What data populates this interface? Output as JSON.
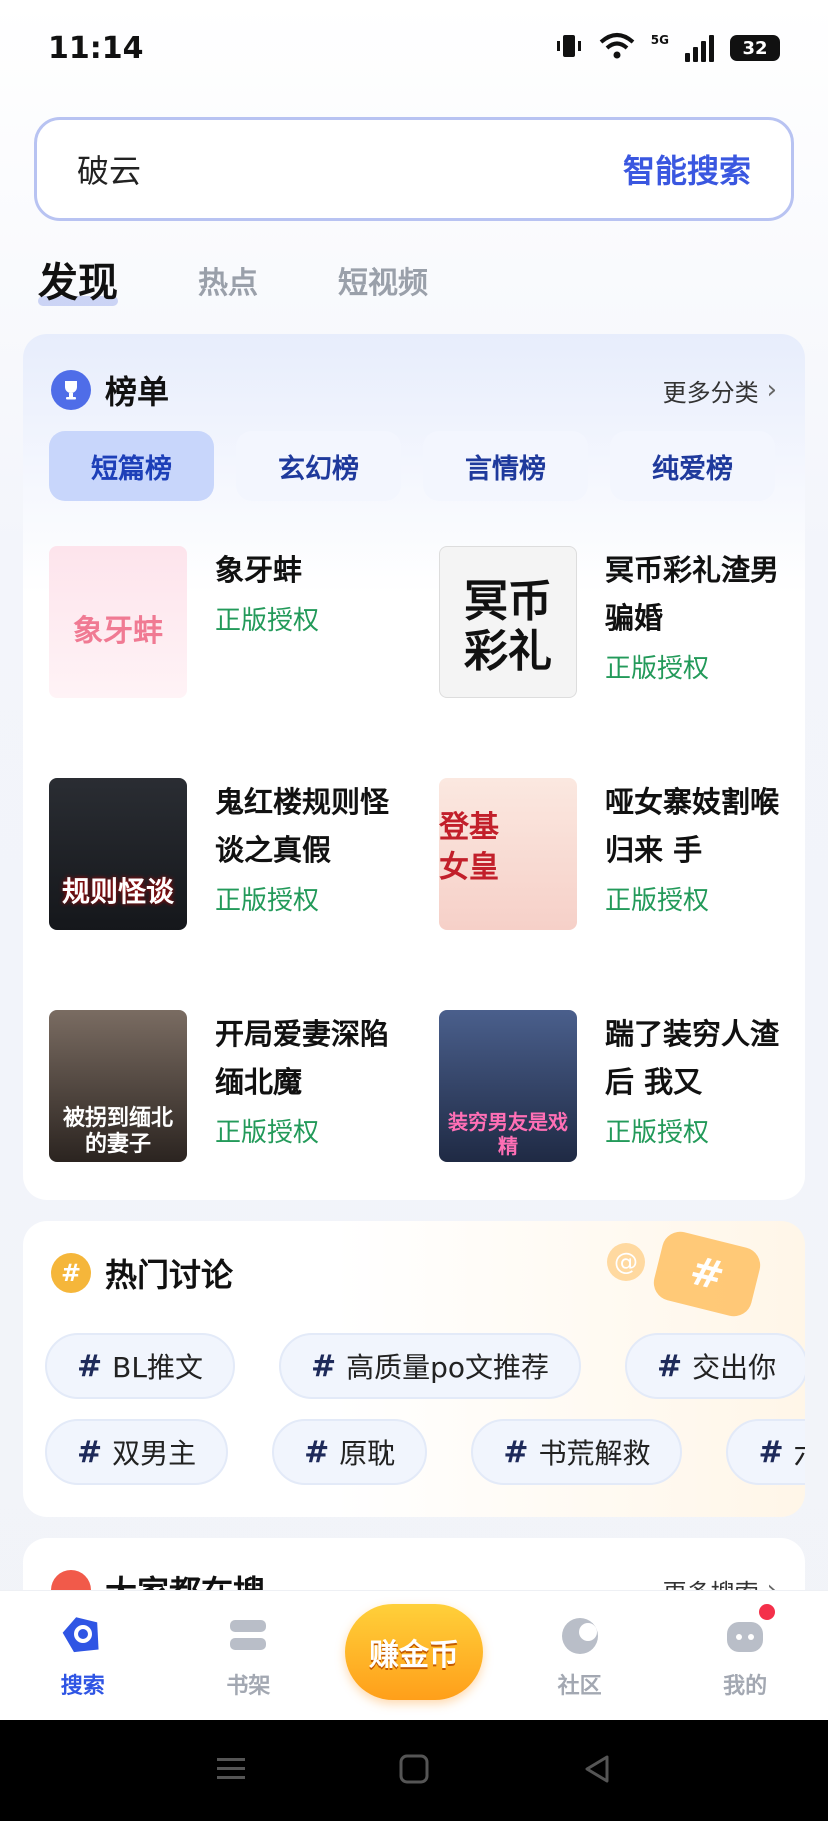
{
  "status_bar": {
    "time": "11:14",
    "network": "5G",
    "battery": "32"
  },
  "search": {
    "query": "破云",
    "action": "智能搜索"
  },
  "tabs": [
    {
      "label": "发现",
      "active": true
    },
    {
      "label": "热点",
      "active": false
    },
    {
      "label": "短视频",
      "active": false
    }
  ],
  "ranking": {
    "title": "榜单",
    "more": "更多分类",
    "tabs": [
      {
        "label": "短篇榜",
        "active": true
      },
      {
        "label": "玄幻榜",
        "active": false
      },
      {
        "label": "言情榜",
        "active": false
      },
      {
        "label": "纯爱榜",
        "active": false
      }
    ],
    "books": [
      {
        "title": "象牙蚌",
        "license": "正版授权",
        "cover_text": "象牙蚌"
      },
      {
        "title": "冥币彩礼渣男骗婚",
        "license": "正版授权",
        "cover_text": "冥币彩礼"
      },
      {
        "title": "鬼红楼规则怪谈之真假",
        "license": "正版授权",
        "cover_text": "规则怪谈"
      },
      {
        "title": "哑女寨妓割喉归来 手",
        "license": "正版授权",
        "cover_text": "登基女皇"
      },
      {
        "title": "开局爱妻深陷缅北魔",
        "license": "正版授权",
        "cover_text": "被拐到缅北的妻子"
      },
      {
        "title": "踹了装穷人渣后 我又",
        "license": "正版授权",
        "cover_text": "装穷男友是戏精"
      }
    ]
  },
  "discussion": {
    "title": "热门讨论",
    "row1": [
      "BL推文",
      "高质量po文推荐",
      "交出你"
    ],
    "row2": [
      "双男主",
      "原耽",
      "书荒解救",
      "六"
    ]
  },
  "popular": {
    "title": "大家都在搜",
    "more": "更多搜索"
  },
  "bottom_nav": {
    "search": "搜索",
    "shelf": "书架",
    "coins": "赚金币",
    "community": "社区",
    "mine": "我的"
  },
  "colors": {
    "accent": "#2f55e4",
    "license_green": "#239a5a",
    "coin_orange": "#ff9f1a"
  }
}
